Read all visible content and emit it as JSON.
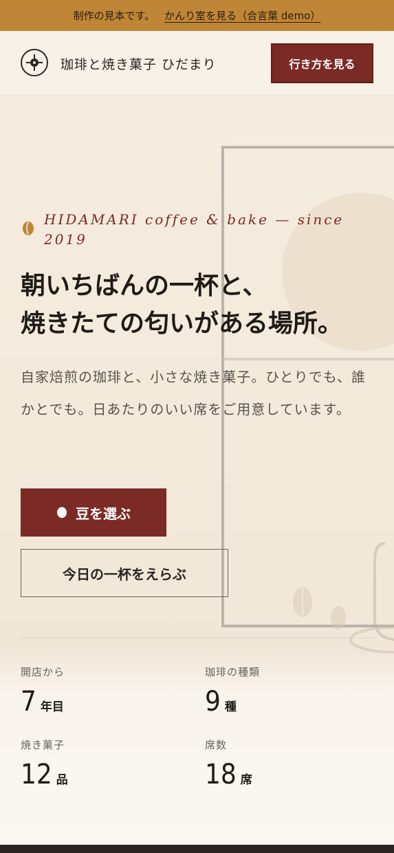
{
  "notice": {
    "text": "制作の見本です。",
    "link_label": "かんり室を見る（合言葉 demo）"
  },
  "header": {
    "brand": "珈琲と焼き菓子 ひだまり",
    "logo_icon": "coffee-bean-logo-icon",
    "access_button": "行き方を見る"
  },
  "hero": {
    "eyebrow": "HIDAMARI coffee & bake — since 2019",
    "eyebrow_icon": "coffee-bean-icon",
    "headline_line1": "朝いちばんの一杯と、",
    "headline_line2": "焼きたての匂いがある場所。",
    "lead": "自家焙煎の珈琲と、小さな焼き菓子。ひとりでも、誰かとでも。日あたりのいい席をご用意しています。",
    "primary_button": "豆を選ぶ",
    "primary_button_icon": "bean-dot-icon",
    "secondary_button": "今日の一杯をえらぶ"
  },
  "stats": [
    {
      "label": "開店から",
      "value": "7",
      "unit": "年目"
    },
    {
      "label": "珈琲の種類",
      "value": "9",
      "unit": "種"
    },
    {
      "label": "焼き菓子",
      "value": "12",
      "unit": "品"
    },
    {
      "label": "席数",
      "value": "18",
      "unit": "席"
    }
  ],
  "colors": {
    "accent": "#7b2a25",
    "notice_bg": "#bf8637",
    "background": "#f6efe4"
  }
}
